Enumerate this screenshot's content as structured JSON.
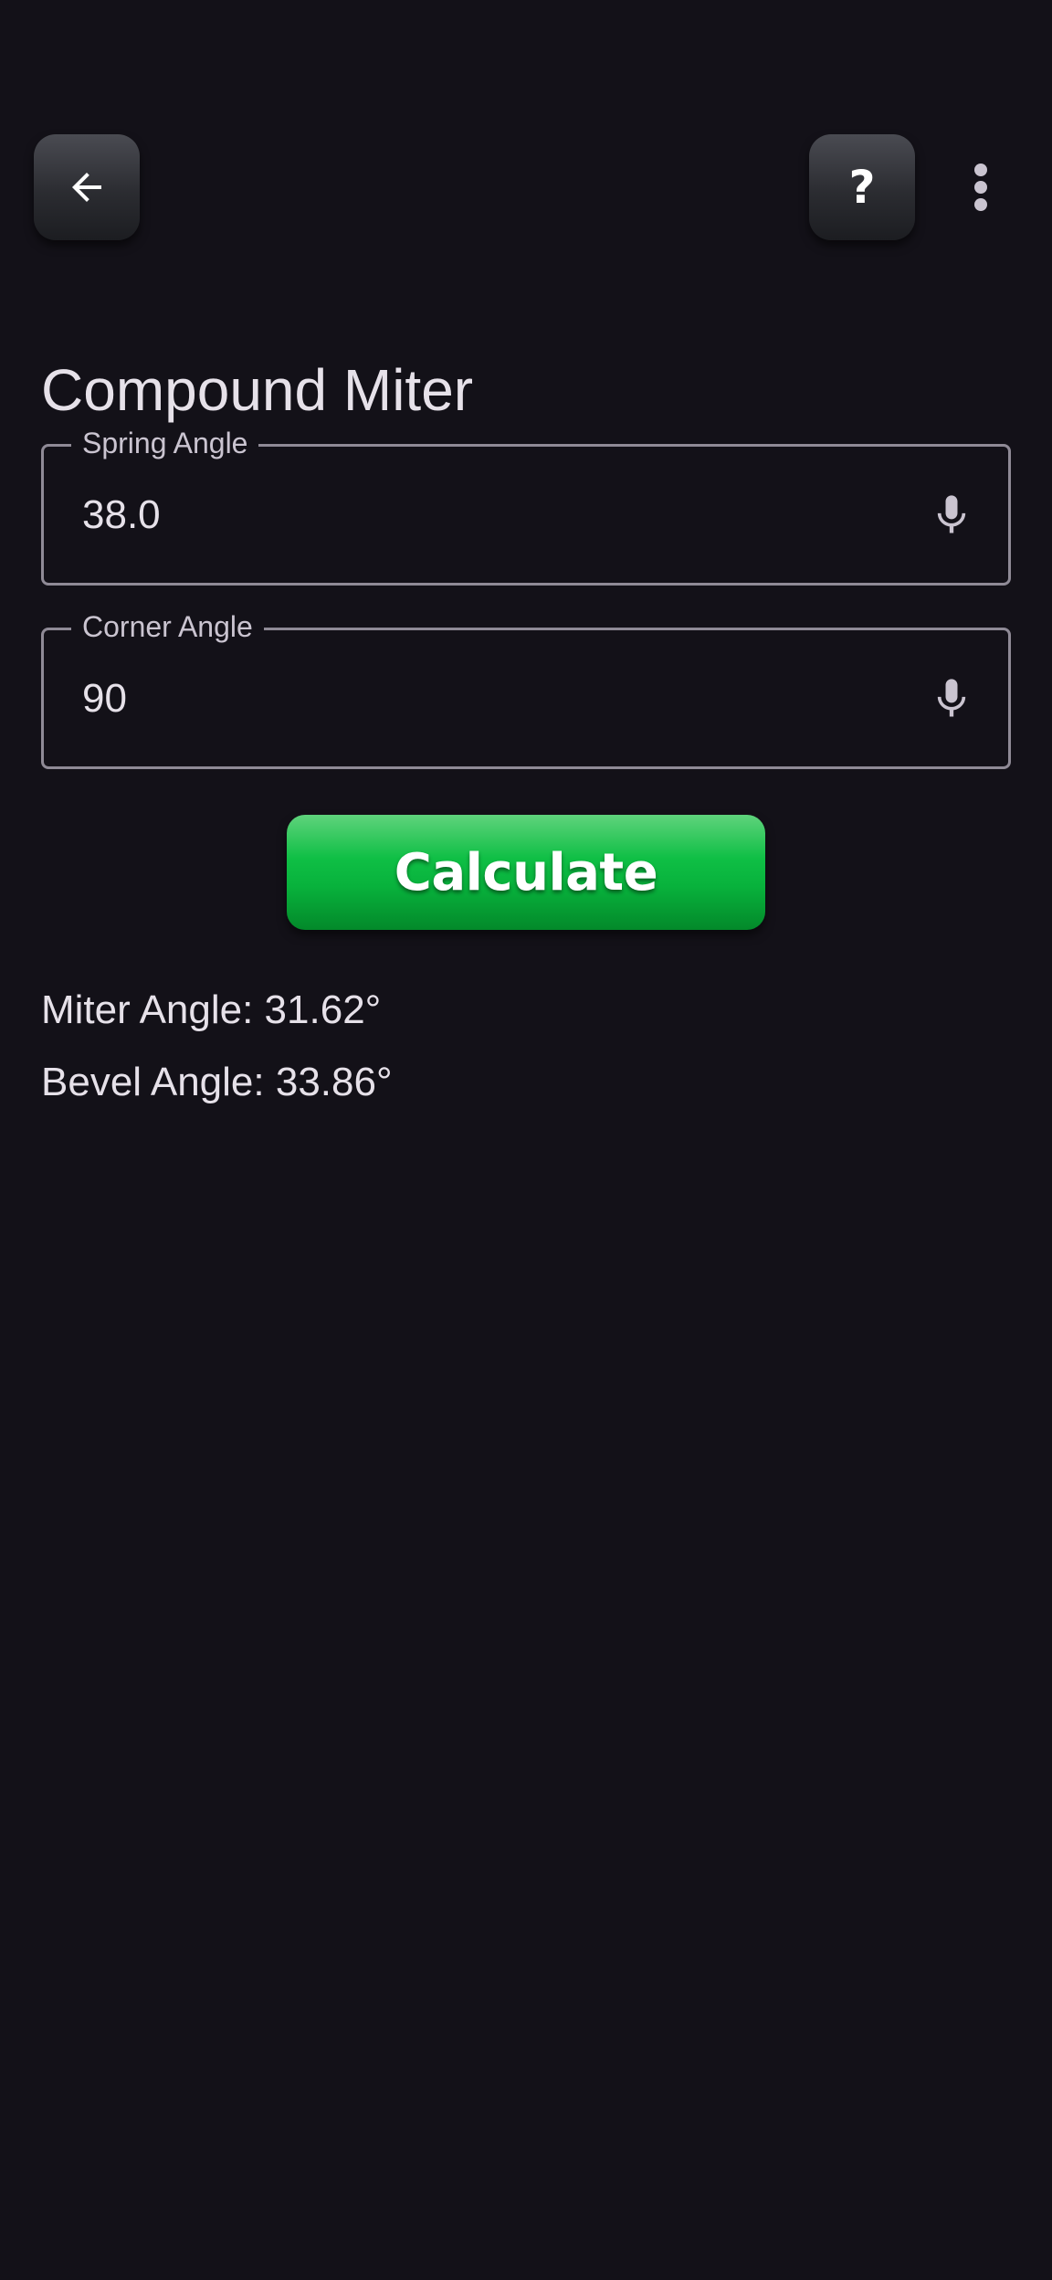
{
  "header": {
    "back_icon": "arrow-back-icon",
    "help_label": "?",
    "more_icon": "more-vert-icon"
  },
  "page": {
    "title": "Compound Miter"
  },
  "form": {
    "spring_angle": {
      "label": "Spring Angle",
      "value": "38.0",
      "icon": "mic-icon"
    },
    "corner_angle": {
      "label": "Corner Angle",
      "value": "90",
      "icon": "mic-icon"
    },
    "calculate_label": "Calculate"
  },
  "results": {
    "miter": "Miter Angle: 31.62°",
    "bevel": "Bevel Angle: 33.86°"
  },
  "colors": {
    "background": "#131118",
    "accent_green": "#08b23c",
    "outline": "#8f8a96",
    "text": "#e6e1e9"
  }
}
